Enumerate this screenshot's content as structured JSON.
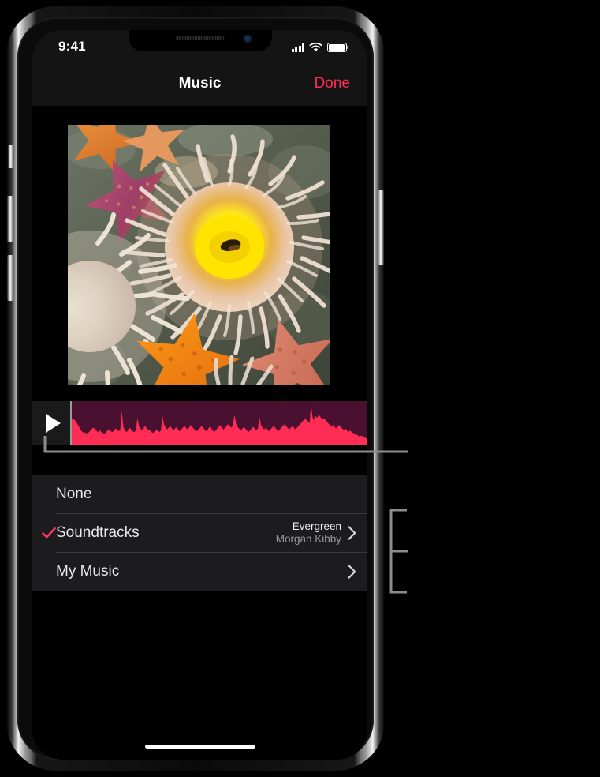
{
  "device": {
    "name": "iphone-x",
    "status_bar": {
      "time": "9:41",
      "cellular_icon": "cellular-bars-icon",
      "wifi_icon": "wifi-icon",
      "battery_icon": "battery-full-icon"
    },
    "notch": {
      "speaker_icon": "speaker-grille-icon",
      "camera_icon": "front-camera-icon"
    },
    "buttons": {
      "silent_switch": "silent-switch",
      "volume_up": "volume-up-button",
      "volume_down": "volume-down-button",
      "power": "power-button"
    },
    "home_indicator": "home-indicator"
  },
  "nav": {
    "title": "Music",
    "done_label": "Done"
  },
  "preview": {
    "name": "video-preview",
    "description": "Underwater photo of sea anemones and starfish"
  },
  "audio": {
    "play_icon": "play-icon",
    "waveform_name": "audio-waveform",
    "waveform_bg_color": "#4A1030",
    "waveform_fill_color": "#FF2D55"
  },
  "options": [
    {
      "label": "None",
      "checked": false,
      "has_chevron": false,
      "meta_title": "",
      "meta_artist": ""
    },
    {
      "label": "Soundtracks",
      "checked": true,
      "has_chevron": true,
      "meta_title": "Evergreen",
      "meta_artist": "Morgan Kibby"
    },
    {
      "label": "My Music",
      "checked": false,
      "has_chevron": true,
      "meta_title": "",
      "meta_artist": ""
    }
  ],
  "colors": {
    "accent": "#FF2D55",
    "check": "#FF375F",
    "row_bg": "#1C1C1E",
    "nav_bg": "#141414",
    "callout": "#8c8c8c"
  },
  "callouts": {
    "play_button_leader": "callout-line-play-button",
    "options_bracket": "callout-bracket-options"
  },
  "chart_data": {
    "type": "area",
    "title": "Audio waveform amplitude",
    "xlabel": "",
    "ylabel": "",
    "ylim": [
      0,
      1
    ],
    "values": [
      0.58,
      0.6,
      0.57,
      0.52,
      0.46,
      0.4,
      0.33,
      0.3,
      0.29,
      0.28,
      0.27,
      0.3,
      0.34,
      0.38,
      0.4,
      0.36,
      0.32,
      0.3,
      0.34,
      0.3,
      0.28,
      0.26,
      0.3,
      0.34,
      0.36,
      0.32,
      0.3,
      0.34,
      0.38,
      0.36,
      0.32,
      0.36,
      0.78,
      0.42,
      0.34,
      0.3,
      0.34,
      0.4,
      0.36,
      0.32,
      0.3,
      0.34,
      0.62,
      0.44,
      0.38,
      0.34,
      0.4,
      0.44,
      0.38,
      0.34,
      0.36,
      0.3,
      0.28,
      0.32,
      0.36,
      0.34,
      0.3,
      0.34,
      0.66,
      0.48,
      0.4,
      0.36,
      0.4,
      0.44,
      0.38,
      0.34,
      0.38,
      0.42,
      0.36,
      0.32,
      0.36,
      0.4,
      0.44,
      0.4,
      0.36,
      0.4,
      0.46,
      0.42,
      0.38,
      0.34,
      0.32,
      0.36,
      0.4,
      0.44,
      0.4,
      0.36,
      0.32,
      0.36,
      0.42,
      0.38,
      0.34,
      0.3,
      0.34,
      0.38,
      0.42,
      0.46,
      0.4,
      0.36,
      0.4,
      0.44,
      0.48,
      0.44,
      0.4,
      0.44,
      0.7,
      0.5,
      0.42,
      0.38,
      0.34,
      0.38,
      0.42,
      0.38,
      0.34,
      0.3,
      0.34,
      0.38,
      0.42,
      0.38,
      0.34,
      0.38,
      0.64,
      0.46,
      0.4,
      0.36,
      0.4,
      0.36,
      0.32,
      0.36,
      0.4,
      0.44,
      0.4,
      0.36,
      0.32,
      0.36,
      0.4,
      0.44,
      0.48,
      0.44,
      0.4,
      0.36,
      0.4,
      0.44,
      0.4,
      0.36,
      0.4,
      0.44,
      0.48,
      0.52,
      0.56,
      0.6,
      0.58,
      0.54,
      0.5,
      0.92,
      0.62,
      0.58,
      0.66,
      0.62,
      0.7,
      0.64,
      0.58,
      0.62,
      0.58,
      0.54,
      0.5,
      0.46,
      0.42,
      0.46,
      0.42,
      0.38,
      0.42,
      0.46,
      0.42,
      0.38,
      0.34,
      0.38,
      0.34,
      0.3,
      0.34,
      0.3,
      0.28,
      0.26,
      0.24,
      0.22,
      0.2,
      0.22,
      0.2,
      0.18,
      0.16,
      0.14
    ]
  }
}
